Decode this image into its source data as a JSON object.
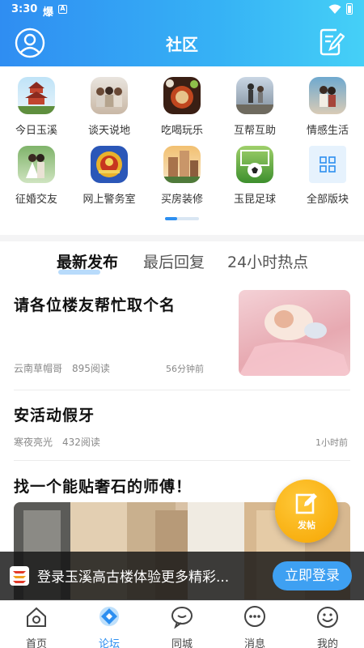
{
  "status_bar": {
    "time": "3:30",
    "icon1": "爆",
    "icon2": "A"
  },
  "header": {
    "title": "社区",
    "left_icon": "user-circle-icon",
    "right_icon": "edit-note-icon"
  },
  "categories": [
    {
      "label": "今日玉溪",
      "icon": "pagoda-photo"
    },
    {
      "label": "谈天说地",
      "icon": "children-photo"
    },
    {
      "label": "吃喝玩乐",
      "icon": "food-photo"
    },
    {
      "label": "互帮互助",
      "icon": "people-photo"
    },
    {
      "label": "情感生活",
      "icon": "couple-photo"
    },
    {
      "label": "征婚交友",
      "icon": "wedding-photo"
    },
    {
      "label": "网上警务室",
      "icon": "police-badge"
    },
    {
      "label": "买房装修",
      "icon": "building-photo"
    },
    {
      "label": "玉昆足球",
      "icon": "soccer-photo"
    },
    {
      "label": "全部版块",
      "icon": "grid-icon"
    }
  ],
  "tabs": [
    {
      "label": "最新发布",
      "active": true
    },
    {
      "label": "最后回复",
      "active": false
    },
    {
      "label": "24小时热点",
      "active": false
    }
  ],
  "posts": [
    {
      "title": "请各位楼友帮忙取个名",
      "author": "云南草帽哥",
      "reads": "895阅读",
      "time": "56分钟前"
    },
    {
      "title": "安活动假牙",
      "author": "寒夜亮光",
      "reads": "432阅读",
      "time": "1小时前"
    },
    {
      "title": "找一个能贴奢石的师傅！"
    }
  ],
  "fab": {
    "label": "发帖"
  },
  "login_banner": {
    "text": "登录玉溪高古楼体验更多精彩...",
    "button": "立即登录"
  },
  "bottom_nav": [
    {
      "label": "首页",
      "icon": "home-icon",
      "active": false
    },
    {
      "label": "论坛",
      "icon": "forum-icon",
      "active": true
    },
    {
      "label": "同城",
      "icon": "chat-bubble-icon",
      "active": false
    },
    {
      "label": "消息",
      "icon": "message-icon",
      "active": false
    },
    {
      "label": "我的",
      "icon": "smiley-icon",
      "active": false
    }
  ],
  "colors": {
    "accent": "#2d8ff0",
    "fab": "#f6a500",
    "header_start": "#2f8df2",
    "header_end": "#45d0f7"
  }
}
